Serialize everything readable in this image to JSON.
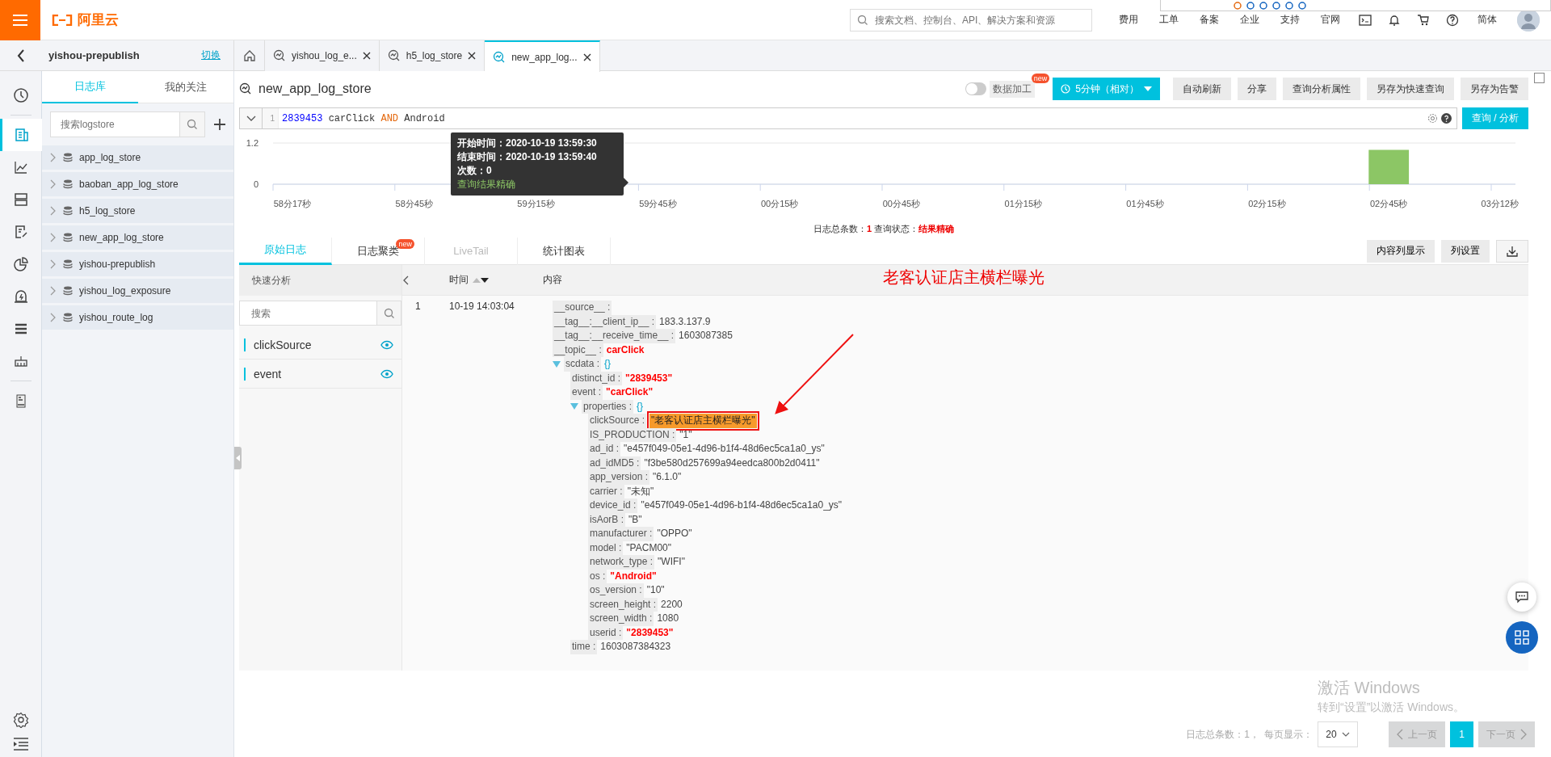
{
  "topbar": {
    "logo": "阿里云",
    "search": {
      "placeholder": "搜索文档、控制台、API、解决方案和资源"
    },
    "nav": [
      "费用",
      "工单",
      "备案",
      "企业",
      "支持",
      "官网"
    ],
    "language": "简体"
  },
  "project": {
    "name": "yishou-prepublish",
    "switch_link": "切换"
  },
  "tabs": [
    {
      "label": "yishou_log_e...",
      "selected": false
    },
    {
      "label": "h5_log_store",
      "selected": false
    },
    {
      "label": "new_app_log...",
      "selected": true
    }
  ],
  "rail": [
    {
      "kind": "clock",
      "selected": false
    },
    {
      "kind": "logstore",
      "selected": true
    },
    {
      "kind": "chart",
      "selected": false
    },
    {
      "kind": "storage",
      "selected": false
    },
    {
      "kind": "edit",
      "selected": false
    },
    {
      "kind": "pie",
      "selected": false
    },
    {
      "kind": "alarm",
      "selected": false
    },
    {
      "kind": "list",
      "selected": false
    },
    {
      "kind": "ruler",
      "selected": false
    },
    {
      "kind": "report",
      "selected": false
    }
  ],
  "sidebar": {
    "tabs": [
      {
        "label": "日志库",
        "selected": true
      },
      {
        "label": "我的关注",
        "selected": false
      }
    ],
    "search": {
      "placeholder": "搜索logstore"
    },
    "items": [
      "app_log_store",
      "baoban_app_log_store",
      "h5_log_store",
      "new_app_log_store",
      "yishou-prepublish",
      "yishou_log_exposure",
      "yishou_route_log"
    ]
  },
  "logstore": {
    "title": "new_app_log_store",
    "data_process": {
      "label": "数据加工",
      "badge": "new",
      "on": false
    },
    "time_range": "5分钟（相对）",
    "buttons": [
      "自动刷新",
      "分享",
      "查询分析属性",
      "另存为快速查询",
      "另存为告警"
    ]
  },
  "query": {
    "line_number": "1",
    "tokens": [
      {
        "text": "2839453",
        "kind": "number"
      },
      {
        "text": "carClick",
        "kind": "plain"
      },
      {
        "text": "AND",
        "kind": "keyword"
      },
      {
        "text": "Android",
        "kind": "plain"
      }
    ],
    "submit": "查询 / 分析"
  },
  "histogram": {
    "chart_data": {
      "type": "bar",
      "categories": [
        "58分17秒",
        "58分45秒",
        "59分15秒",
        "59分45秒",
        "00分15秒",
        "00分45秒",
        "01分15秒",
        "01分45秒",
        "02分15秒",
        "02分45秒",
        "03分12秒"
      ],
      "series": [
        {
          "color": "#8cc665",
          "values": [
            0,
            0,
            0,
            0,
            0,
            0,
            0,
            0,
            0,
            1,
            0
          ]
        }
      ],
      "ylim": [
        0,
        1.2
      ],
      "yticks": [
        0,
        1.2
      ]
    },
    "tooltip": {
      "lines": [
        {
          "label": "开始时间：",
          "value": "2020-10-19 13:59:30"
        },
        {
          "label": "结束时间：",
          "value": "2020-10-19 13:59:40"
        },
        {
          "label": "次数：",
          "value": "0"
        }
      ],
      "link": "查询结果精确"
    }
  },
  "summary": {
    "count_label": "日志总条数：",
    "count": "1",
    "status_label": "查询状态：",
    "status": "结果精确"
  },
  "log_tabs": [
    {
      "label": "原始日志",
      "selected": true,
      "disabled": false
    },
    {
      "label": "日志聚类",
      "badge": "new",
      "selected": false,
      "disabled": false
    },
    {
      "label": "LiveTail",
      "selected": false,
      "disabled": true
    },
    {
      "label": "统计图表",
      "selected": false,
      "disabled": false
    }
  ],
  "log_actions": [
    "内容列显示",
    "列设置"
  ],
  "quick_analysis": {
    "title": "快速分析",
    "search": {
      "placeholder": "搜索"
    },
    "fields": [
      "clickSource",
      "event"
    ]
  },
  "table": {
    "columns": [
      "时间",
      "内容"
    ],
    "rows": [
      {
        "index": "1",
        "time": "10-19 14:03:04",
        "fields": [
          {
            "key": "__source__ :"
          },
          {
            "key": "__tag__:__client_ip__ :",
            "value": "183.3.137.9",
            "kind": "plain"
          },
          {
            "key": "__tag__:__receive_time__ :",
            "value": "1603087385",
            "kind": "plain"
          },
          {
            "key": "__topic__ :",
            "value": "carClick",
            "kind": "red"
          },
          {
            "key": "scdata :",
            "value": "{}",
            "kind": "brace",
            "expanded": true,
            "children": [
              {
                "key": "distinct_id :",
                "value": "\"2839453\"",
                "kind": "red"
              },
              {
                "key": "event :",
                "value": "\"carClick\"",
                "kind": "red"
              },
              {
                "key": "properties :",
                "value": "{}",
                "kind": "brace",
                "expanded": true,
                "children": [
                  {
                    "key": "clickSource :",
                    "value": "\"老客认证店主横栏曝光\"",
                    "kind": "highlight"
                  },
                  {
                    "key": "IS_PRODUCTION :",
                    "value": "\"1\"",
                    "kind": "plain"
                  },
                  {
                    "key": "ad_id :",
                    "value": "\"e457f049-05e1-4d96-b1f4-48d6ec5ca1a0_ys\"",
                    "kind": "plain"
                  },
                  {
                    "key": "ad_idMD5 :",
                    "value": "\"f3be580d257699a94eedca800b2d0411\"",
                    "kind": "plain"
                  },
                  {
                    "key": "app_version :",
                    "value": "\"6.1.0\"",
                    "kind": "plain"
                  },
                  {
                    "key": "carrier :",
                    "value": "\"未知\"",
                    "kind": "plain"
                  },
                  {
                    "key": "device_id :",
                    "value": "\"e457f049-05e1-4d96-b1f4-48d6ec5ca1a0_ys\"",
                    "kind": "plain"
                  },
                  {
                    "key": "isAorB :",
                    "value": "\"B\"",
                    "kind": "plain"
                  },
                  {
                    "key": "manufacturer :",
                    "value": "\"OPPO\"",
                    "kind": "plain"
                  },
                  {
                    "key": "model :",
                    "value": "\"PACM00\"",
                    "kind": "plain"
                  },
                  {
                    "key": "network_type :",
                    "value": "\"WIFI\"",
                    "kind": "plain"
                  },
                  {
                    "key": "os :",
                    "value": "\"Android\"",
                    "kind": "red"
                  },
                  {
                    "key": "os_version :",
                    "value": "\"10\"",
                    "kind": "plain"
                  },
                  {
                    "key": "screen_height :",
                    "value": "2200",
                    "kind": "plain"
                  },
                  {
                    "key": "screen_width :",
                    "value": "1080",
                    "kind": "plain"
                  },
                  {
                    "key": "userid :",
                    "value": "\"2839453\"",
                    "kind": "red"
                  }
                ]
              },
              {
                "key": "time :",
                "value": "1603087384323",
                "kind": "plain"
              }
            ]
          }
        ]
      }
    ]
  },
  "annotation": {
    "text": "老客认证店主横栏曝光"
  },
  "pagination": {
    "total": "日志总条数：1，",
    "page_size_label": "每页显示：",
    "page_size": "20",
    "prev": "上一页",
    "pages": [
      {
        "label": "1",
        "selected": true
      }
    ],
    "next": "下一页"
  },
  "windows_notice": {
    "title": "激活 Windows",
    "text": "转到“设置”以激活 Windows。"
  }
}
